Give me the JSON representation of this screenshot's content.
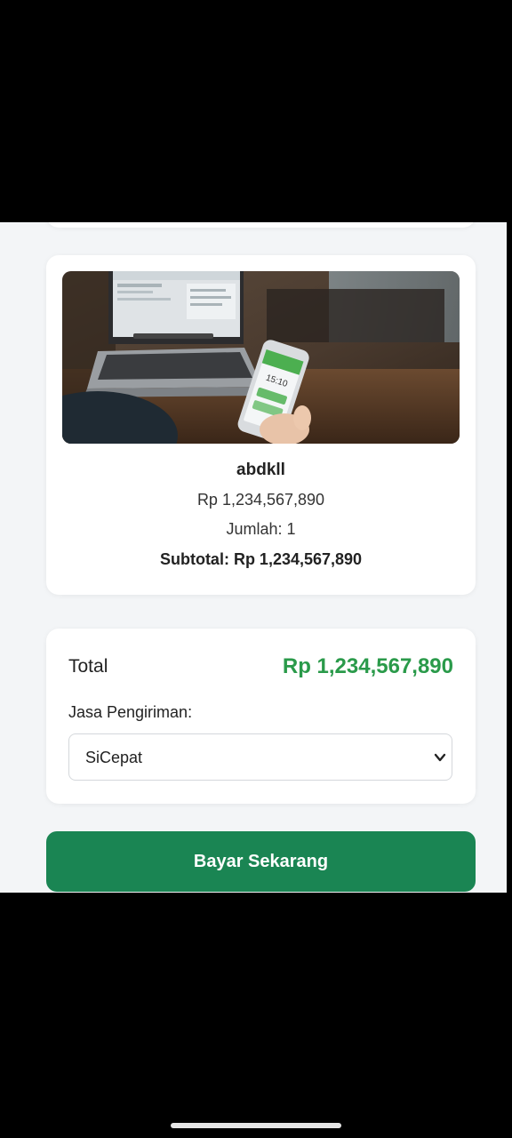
{
  "product": {
    "image_alt": "laptop-and-phone-photo",
    "phone_time": "15:10",
    "name": "abdkll",
    "price": "Rp 1,234,567,890",
    "quantity": "Jumlah: 1",
    "subtotal": "Subtotal: Rp 1,234,567,890"
  },
  "summary": {
    "total_label": "Total",
    "total_amount": "Rp 1,234,567,890",
    "shipping_label": "Jasa Pengiriman:",
    "shipping_selected": "SiCepat",
    "chevron_icon": "chevron-down-icon"
  },
  "actions": {
    "pay_label": "Bayar Sekarang"
  },
  "colors": {
    "accent_green": "#2a9a4a",
    "button_green": "#1a8553",
    "page_bg": "#f3f5f7"
  }
}
